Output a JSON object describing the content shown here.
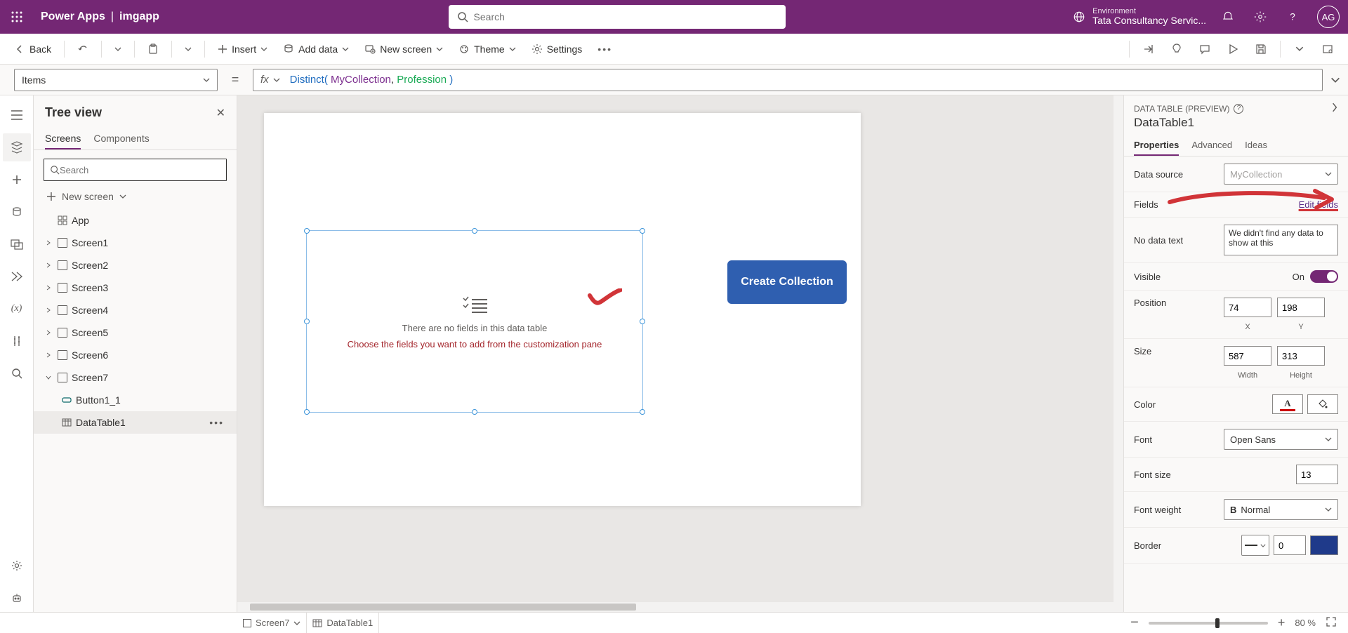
{
  "top": {
    "brand": "Power Apps",
    "appname": "imgapp",
    "search_placeholder": "Search",
    "env_label": "Environment",
    "env_value": "Tata Consultancy Servic...",
    "avatar": "AG"
  },
  "cmd": {
    "back": "Back",
    "insert": "Insert",
    "adddata": "Add data",
    "newscreen": "New screen",
    "theme": "Theme",
    "settings": "Settings"
  },
  "fx": {
    "property": "Items",
    "eq": "=",
    "fx": "fx",
    "formula_fn": "Distinct",
    "formula_arg1": "MyCollection",
    "formula_arg2": "Profession"
  },
  "tree": {
    "title": "Tree view",
    "tab_screens": "Screens",
    "tab_components": "Components",
    "search_placeholder": "Search",
    "newscreen": "New screen",
    "app": "App",
    "screens": [
      "Screen1",
      "Screen2",
      "Screen3",
      "Screen4",
      "Screen5",
      "Screen6",
      "Screen7"
    ],
    "screen7_children": {
      "button": "Button1_1",
      "datatable": "DataTable1"
    }
  },
  "canvas": {
    "dt_msg1": "There are no fields in this data table",
    "dt_msg2": "Choose the fields you want to add from the customization pane",
    "create_btn": "Create Collection"
  },
  "props": {
    "header": "DATA TABLE (PREVIEW)",
    "name": "DataTable1",
    "tab_props": "Properties",
    "tab_adv": "Advanced",
    "tab_ideas": "Ideas",
    "rows": {
      "data_source_lbl": "Data source",
      "data_source_val": "MyCollection",
      "fields_lbl": "Fields",
      "fields_link": "Edit fields",
      "nodata_lbl": "No data text",
      "nodata_val": "We didn't find any data to show at this",
      "visible_lbl": "Visible",
      "visible_val": "On",
      "position_lbl": "Position",
      "pos_x": "74",
      "pos_y": "198",
      "x_lbl": "X",
      "y_lbl": "Y",
      "size_lbl": "Size",
      "w": "587",
      "h": "313",
      "w_lbl": "Width",
      "h_lbl": "Height",
      "color_lbl": "Color",
      "font_lbl": "Font",
      "font_val": "Open Sans",
      "fontsize_lbl": "Font size",
      "fontsize_val": "13",
      "fontweight_lbl": "Font weight",
      "fontweight_val": "Normal",
      "fontweight_b": "B",
      "border_lbl": "Border",
      "border_val": "0"
    }
  },
  "status": {
    "crumb1": "Screen7",
    "crumb2": "DataTable1",
    "zoom": "80  %"
  }
}
